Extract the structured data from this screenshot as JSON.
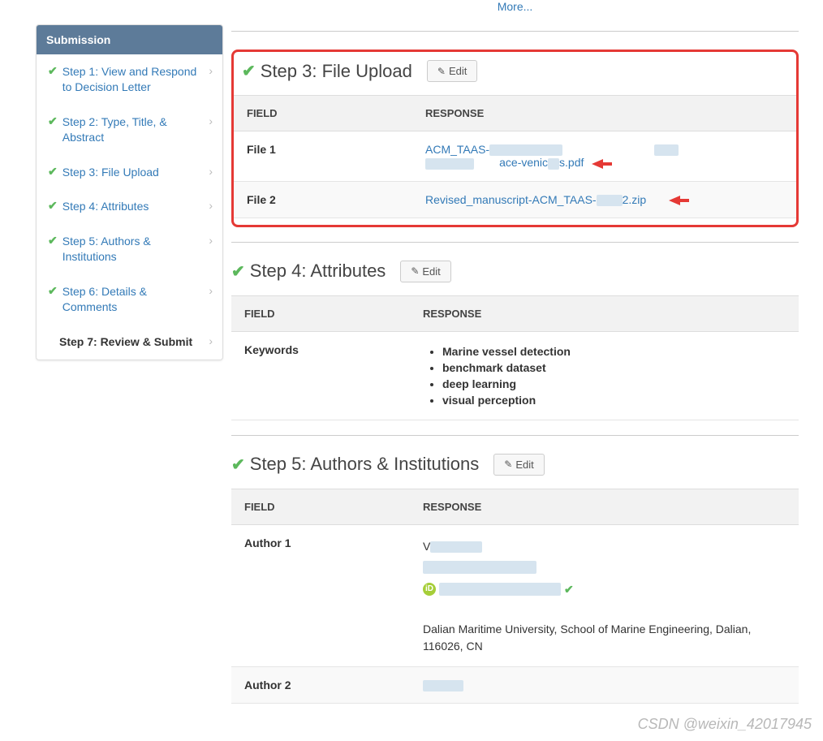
{
  "top_more": "More...",
  "sidebar": {
    "title": "Submission",
    "items": [
      {
        "label": "Step 1: View and Respond to Decision Letter",
        "done": true
      },
      {
        "label": "Step 2: Type, Title, & Abstract",
        "done": true
      },
      {
        "label": "Step 3: File Upload",
        "done": true
      },
      {
        "label": "Step 4: Attributes",
        "done": true
      },
      {
        "label": "Step 5: Authors & Institutions",
        "done": true
      },
      {
        "label": "Step 6: Details & Comments",
        "done": true
      },
      {
        "label": "Step 7: Review & Submit",
        "done": false,
        "active": true
      }
    ]
  },
  "labels": {
    "edit": "Edit",
    "field": "FIELD",
    "response": "RESPONSE"
  },
  "step3": {
    "title": "Step 3: File Upload",
    "rows": [
      {
        "field": "File 1",
        "link_prefix": "ACM_TAAS-",
        "link_mid": "ace-venic",
        "link_suffix": "s.pdf"
      },
      {
        "field": "File 2",
        "link_prefix": "Revised_manuscript-ACM_TAAS-",
        "link_suffix": "2.zip"
      }
    ]
  },
  "step4": {
    "title": "Step 4: Attributes",
    "rows": [
      {
        "field": "Keywords",
        "values": [
          "Marine vessel detection",
          "benchmark dataset",
          "deep learning",
          "visual perception"
        ]
      }
    ]
  },
  "step5": {
    "title": "Step 5: Authors & Institutions",
    "rows": [
      {
        "field": "Author 1",
        "affil": "Dalian Maritime University, School of Marine Engineering, Dalian, 116026, CN"
      },
      {
        "field": "Author 2"
      }
    ]
  },
  "watermark": "CSDN @weixin_42017945"
}
